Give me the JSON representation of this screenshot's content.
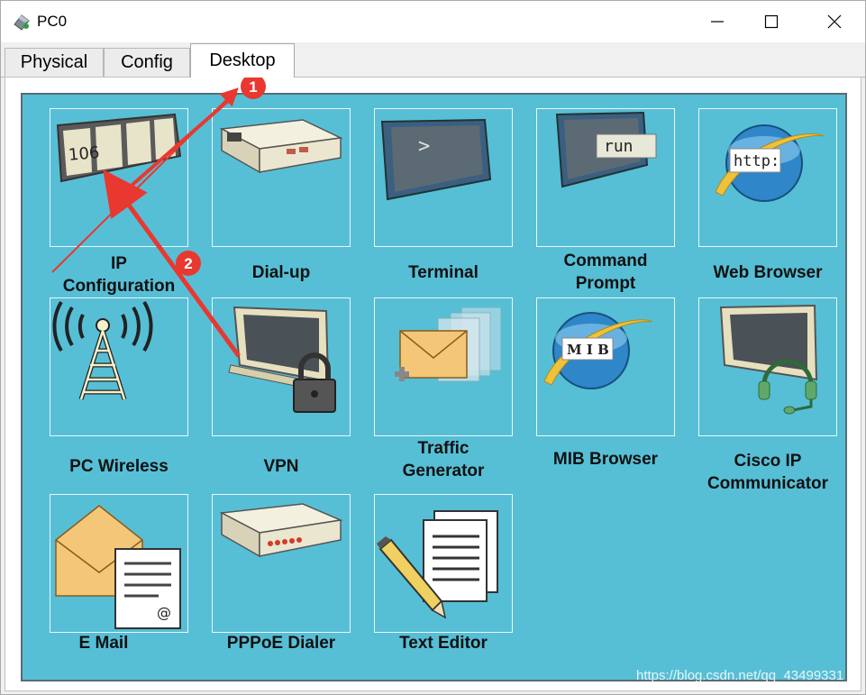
{
  "window": {
    "title": "PC0",
    "controls": [
      "minimize-icon",
      "maximize-icon",
      "close-icon"
    ]
  },
  "tabs": [
    {
      "label": "Physical",
      "active": false
    },
    {
      "label": "Config",
      "active": false
    },
    {
      "label": "Desktop",
      "active": true
    }
  ],
  "apps": [
    {
      "label": "IP\nConfiguration",
      "icon": "ip-configuration-icon",
      "icon_text": "106"
    },
    {
      "label": "Dial-up",
      "icon": "modem-icon"
    },
    {
      "label": "Terminal",
      "icon": "terminal-icon",
      "icon_text": ">"
    },
    {
      "label": "Command\nPrompt",
      "icon": "command-prompt-icon",
      "icon_text": "run"
    },
    {
      "label": "Web Browser",
      "icon": "web-browser-icon",
      "icon_text": "http:"
    },
    {
      "label": "PC Wireless",
      "icon": "wireless-tower-icon"
    },
    {
      "label": "VPN",
      "icon": "vpn-lock-icon"
    },
    {
      "label": "Traffic\nGenerator",
      "icon": "traffic-generator-icon"
    },
    {
      "label": "MIB Browser",
      "icon": "mib-browser-icon",
      "icon_text": "M I B"
    },
    {
      "label": "Cisco IP\nCommunicator",
      "icon": "ip-communicator-icon"
    },
    {
      "label": "E Mail",
      "icon": "email-icon",
      "icon_text": "@"
    },
    {
      "label": "PPPoE Dialer",
      "icon": "pppoe-dialer-icon"
    },
    {
      "label": "Text Editor",
      "icon": "text-editor-icon"
    }
  ],
  "annotations": [
    {
      "number": "1",
      "color": "#e8382f"
    },
    {
      "number": "2",
      "color": "#e8382f"
    }
  ],
  "watermark": "https://blog.csdn.net/qq_43499331",
  "colors": {
    "desktop_bg": "#56bfd6",
    "annotation": "#e8382f"
  }
}
